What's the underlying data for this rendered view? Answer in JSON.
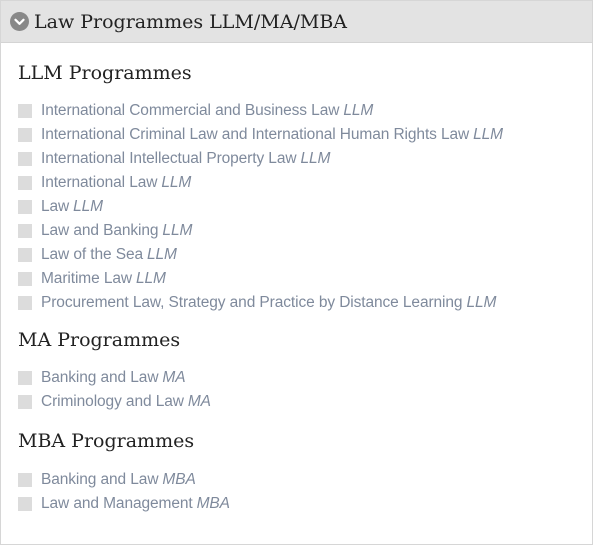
{
  "panel": {
    "title": "Law Programmes LLM/MA/MBA",
    "toggle_icon": "chevron-down-circle-icon"
  },
  "colors": {
    "header_bg": "#e3e3e3",
    "link_text": "#7f8a9c",
    "heading_text": "#222222",
    "bullet": "#dcdcdc",
    "toggle_icon_bg": "#888888"
  },
  "sections": [
    {
      "title": "LLM Programmes",
      "items": [
        {
          "name": "International Commercial and Business Law",
          "degree": "LLM"
        },
        {
          "name": "International Criminal Law and International Human Rights Law",
          "degree": "LLM"
        },
        {
          "name": "International Intellectual Property Law",
          "degree": "LLM"
        },
        {
          "name": "International Law",
          "degree": "LLM"
        },
        {
          "name": "Law",
          "degree": "LLM"
        },
        {
          "name": "Law and Banking",
          "degree": "LLM"
        },
        {
          "name": "Law of the Sea",
          "degree": "LLM"
        },
        {
          "name": "Maritime Law",
          "degree": "LLM"
        },
        {
          "name": "Procurement Law, Strategy and Practice by Distance Learning",
          "degree": "LLM"
        }
      ]
    },
    {
      "title": "MA Programmes",
      "items": [
        {
          "name": "Banking and Law",
          "degree": "MA"
        },
        {
          "name": "Criminology and Law",
          "degree": "MA"
        }
      ]
    },
    {
      "title": "MBA Programmes",
      "items": [
        {
          "name": "Banking and Law",
          "degree": "MBA"
        },
        {
          "name": "Law and Management",
          "degree": "MBA"
        }
      ]
    }
  ]
}
